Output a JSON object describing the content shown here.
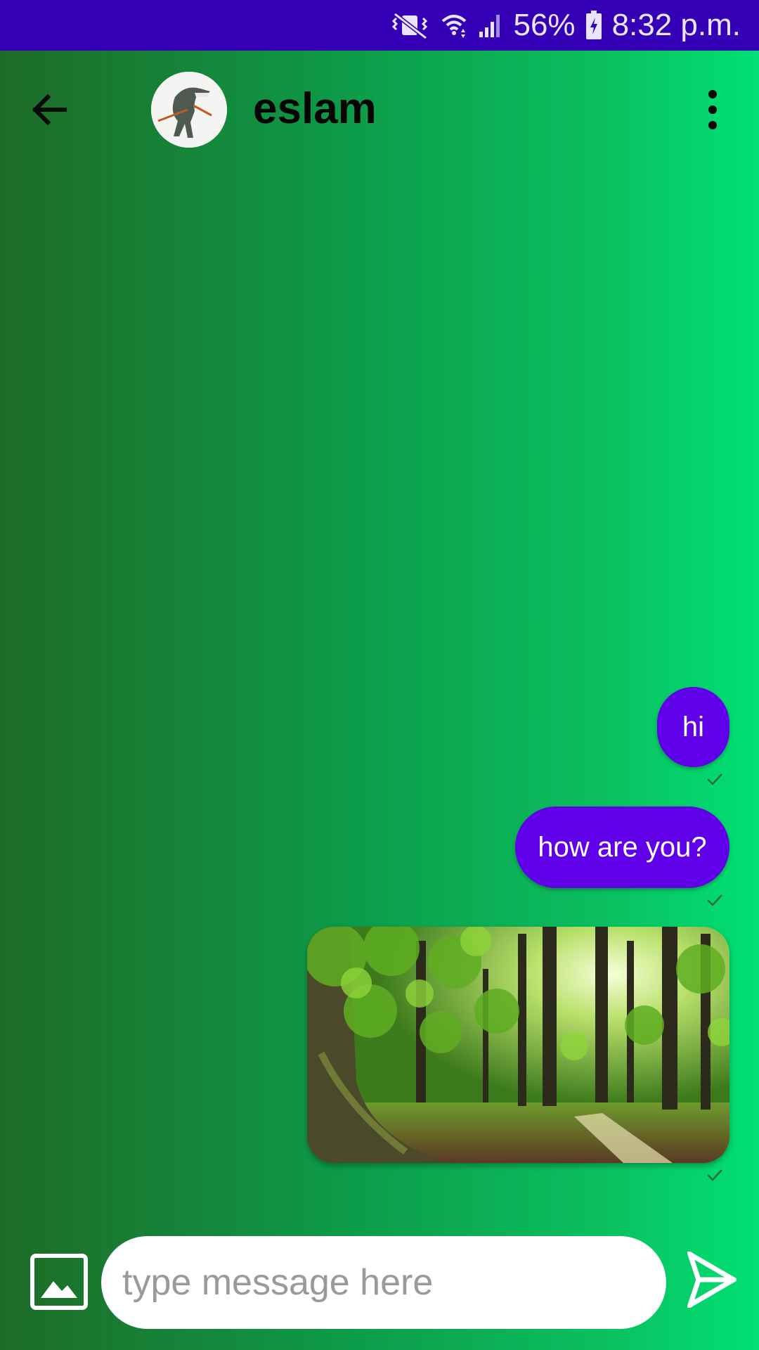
{
  "status_bar": {
    "battery": "56%",
    "time": "8:32 p.m.",
    "icons": [
      "vibrate-mute-icon",
      "wifi-icon",
      "cell-signal-icon",
      "battery-charging-icon"
    ]
  },
  "toolbar": {
    "contact_name": "eslam",
    "icons": [
      "back-arrow-icon",
      "more-vert-icon"
    ]
  },
  "messages": [
    {
      "type": "text",
      "text": "hi",
      "status": "sent"
    },
    {
      "type": "text",
      "text": "how are you?",
      "status": "sent"
    },
    {
      "type": "image",
      "content": "forest photo",
      "status": "sent"
    }
  ],
  "composer": {
    "placeholder": "type message here",
    "value": "",
    "icons": [
      "image-attach-icon",
      "send-icon"
    ]
  },
  "colors": {
    "status_bar": "#3500b5",
    "bubble": "#5f00e8",
    "gradient_start": "#1e6b26",
    "gradient_end": "#00e074"
  }
}
